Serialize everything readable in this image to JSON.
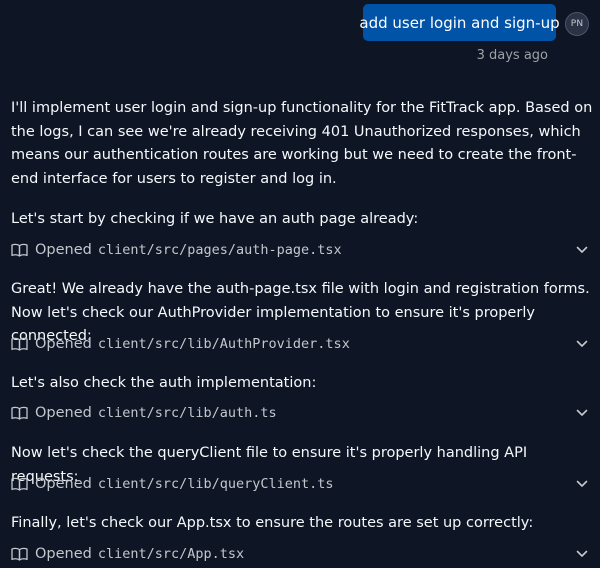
{
  "user_message": {
    "text": "add user login and sign-up",
    "avatar_initials": "PN",
    "timestamp": "3 days ago"
  },
  "response": {
    "intro": "I'll implement user login and sign-up functionality for the FitTrack app. Based on the logs, I can see we're already receiving 401 Unauthorized responses, which means our authentication routes are working but we need to create the front-end interface for users to register and log in.",
    "steps": [
      {
        "text": "Let's start by checking if we have an auth page already:",
        "action": "Opened",
        "path": "client/src/pages/auth-page.tsx"
      },
      {
        "text": "Great! We already have the auth-page.tsx file with login and registration forms. Now let's check our AuthProvider implementation to ensure it's properly connected:",
        "action": "Opened",
        "path": "client/src/lib/AuthProvider.tsx"
      },
      {
        "text": "Let's also check the auth implementation:",
        "action": "Opened",
        "path": "client/src/lib/auth.ts"
      },
      {
        "text": "Now let's check the queryClient file to ensure it's properly handling API requests:",
        "action": "Opened",
        "path": "client/src/lib/queryClient.ts"
      },
      {
        "text": "Finally, let's check our App.tsx to ensure the routes are set up correctly:",
        "action": "Opened",
        "path": "client/src/App.tsx"
      }
    ]
  },
  "icons": {
    "file_action": "book-open-icon",
    "expand": "chevron-down-icon"
  },
  "colors": {
    "background": "#0e1525",
    "user_bubble": "#0053a6",
    "text": "#f5f9fc",
    "muted_text": "#c2c8cc",
    "timestamp": "#9da2a6"
  }
}
